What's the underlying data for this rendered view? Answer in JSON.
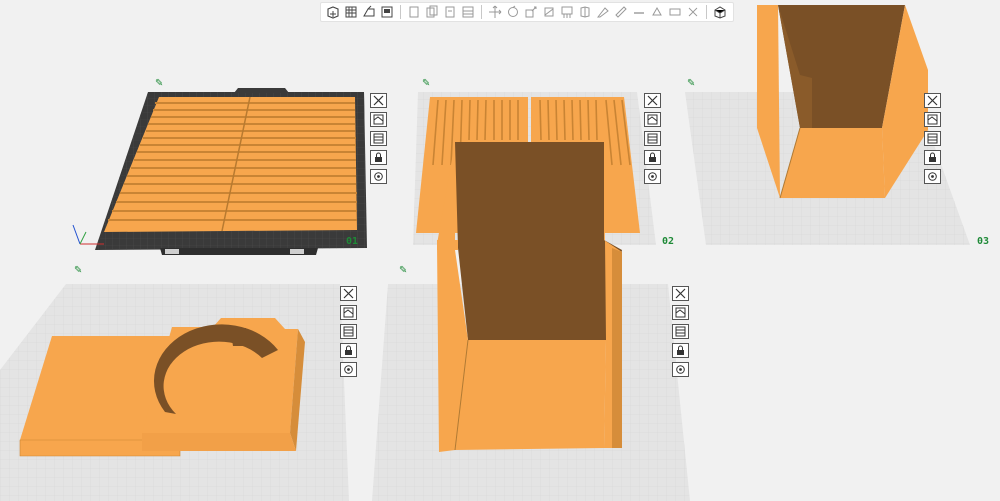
{
  "colors": {
    "background": "#f1f1f1",
    "model_orange": "#f7a64d",
    "model_dark": "#7a5026",
    "model_mid": "#c98434",
    "plate_grid": "#d6d6d6",
    "plate_number": "#1e8a37",
    "bed_dark": "#3a3a3a"
  },
  "toolbar": {
    "groups": [
      [
        "add-icon",
        "arrange-icon",
        "orient-icon",
        "layer-icon"
      ],
      [
        "copy-icon",
        "paste-icon",
        "delete-icon",
        "split-icon"
      ],
      [
        "move-icon",
        "rotate-icon",
        "scale-icon",
        "cut-icon",
        "support-icon",
        "seam-icon",
        "paint-icon",
        "measure-icon",
        "text-icon",
        "mesh-boolean-icon",
        "assembly-icon",
        "emboss-icon"
      ],
      [
        "view-icon"
      ]
    ]
  },
  "plates": [
    {
      "number": "01",
      "edit_mark": "✎",
      "tools": [
        "close-icon",
        "arrange-icon",
        "orient-icon",
        "lock-icon",
        "settings-icon"
      ]
    },
    {
      "number": "02",
      "edit_mark": "✎",
      "tools": [
        "close-icon",
        "arrange-icon",
        "orient-icon",
        "lock-icon",
        "settings-icon"
      ]
    },
    {
      "number": "03",
      "edit_mark": "✎",
      "tools": [
        "close-icon",
        "arrange-icon",
        "orient-icon",
        "lock-icon",
        "settings-icon"
      ]
    },
    {
      "number": "",
      "edit_mark": "✎",
      "tools": [
        "close-icon",
        "arrange-icon",
        "orient-icon",
        "lock-icon",
        "settings-icon"
      ]
    },
    {
      "number": "",
      "edit_mark": "✎",
      "tools": [
        "close-icon",
        "arrange-icon",
        "orient-icon",
        "lock-icon",
        "settings-icon"
      ]
    }
  ]
}
